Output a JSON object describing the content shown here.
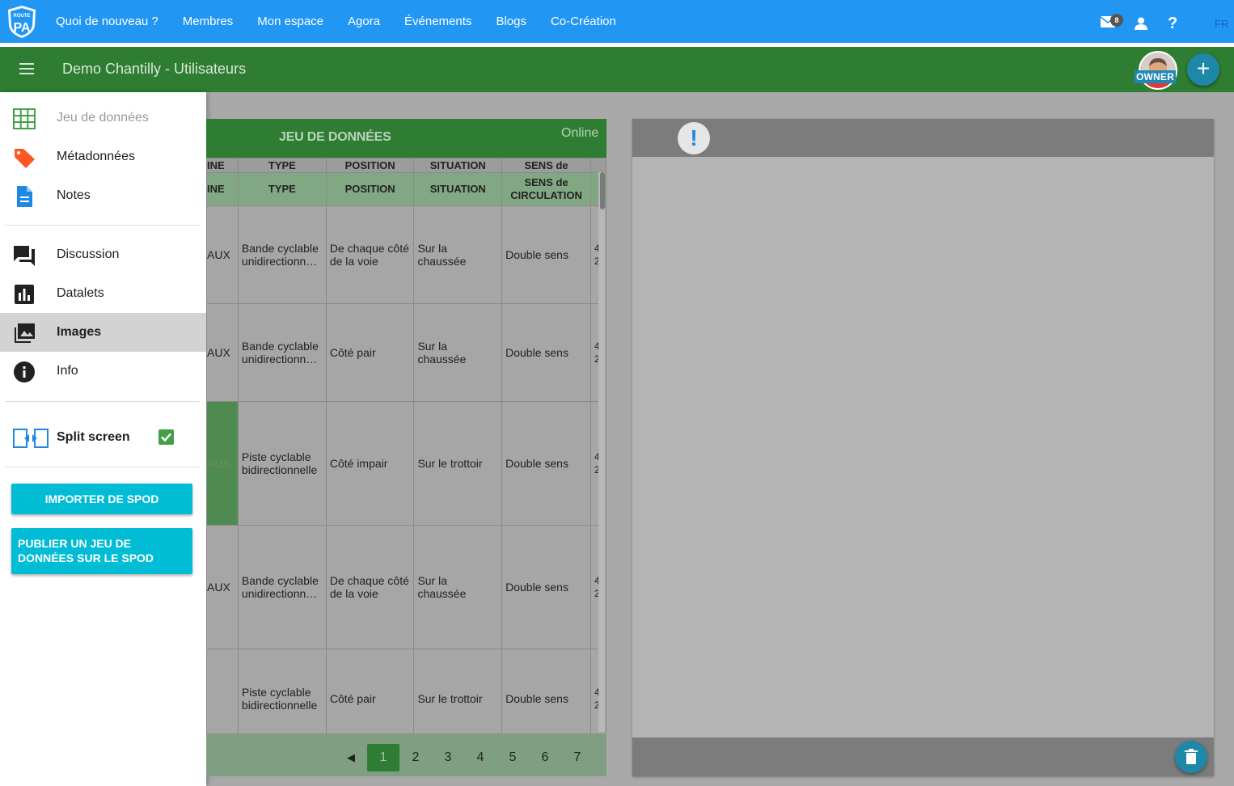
{
  "topnav": {
    "logo_text": "ROUTE TO PA",
    "links": [
      "Quoi de nouveau ?",
      "Membres",
      "Mon espace",
      "Agora",
      "Événements",
      "Blogs",
      "Co-Création"
    ],
    "mail_badge": "8",
    "help": "?",
    "lang": "FR"
  },
  "header": {
    "title": "Demo Chantilly - Utilisateurs",
    "owner_label": "OWNER",
    "add_label": "+"
  },
  "sidebar": {
    "items": [
      {
        "label": "Jeu de données",
        "icon": "grid-icon"
      },
      {
        "label": "Métadonnées",
        "icon": "tag-icon"
      },
      {
        "label": "Notes",
        "icon": "document-icon"
      },
      {
        "label": "Discussion",
        "icon": "forum-icon"
      },
      {
        "label": "Datalets",
        "icon": "bar-chart-icon"
      },
      {
        "label": "Images",
        "icon": "images-icon"
      },
      {
        "label": "Info",
        "icon": "info-icon"
      }
    ],
    "split_screen_label": "Split screen",
    "split_screen_checked": true,
    "import_button": "IMPORTER DE SPOD",
    "publish_button": "PUBLIER UN JEU DE DONNÉES SUR LE SPOD"
  },
  "dataset": {
    "title": "JEU DE DONNÉES",
    "status": "Online",
    "header_row1": [
      "INE",
      "TYPE",
      "POSITION",
      "SITUATION",
      "SENS de",
      ""
    ],
    "header_row2": [
      "INE",
      "TYPE",
      "POSITION",
      "SITUATION",
      "SENS de CIRCULATION",
      ""
    ],
    "rows": [
      {
        "c0": "AUX",
        "type": "Bande cyclable unidirectionn…",
        "position": "De chaque côté de la voie",
        "situation": "Sur la chaussée",
        "sens": "Double sens",
        "c5": "4 2"
      },
      {
        "c0": "AUX",
        "type": "Bande cyclable unidirectionn…",
        "position": "Côté pair",
        "situation": "Sur la chaussée",
        "sens": "Double sens",
        "c5": "4 2"
      },
      {
        "c0": "AUX",
        "type": "Piste cyclable bidirectionnelle",
        "position": "Côté impair",
        "situation": "Sur le trottoir",
        "sens": "Double sens",
        "c5": "4 2"
      },
      {
        "c0": "AUX",
        "type": "Bande cyclable unidirectionn…",
        "position": "De chaque côté de la voie",
        "situation": "Sur la chaussée",
        "sens": "Double sens",
        "c5": "4 2"
      },
      {
        "c0": "",
        "type": "Piste cyclable bidirectionnelle",
        "position": "Côté pair",
        "situation": "Sur le trottoir",
        "sens": "Double sens",
        "c5": "4 2"
      }
    ],
    "pager": {
      "prev": "◀",
      "pages": [
        "1",
        "2",
        "3",
        "4",
        "5",
        "6",
        "7"
      ],
      "current": "1"
    }
  },
  "preview": {
    "alert_symbol": "!"
  },
  "colors": {
    "nav_blue": "#2196f3",
    "header_green": "#2e7d32",
    "button_cyan": "#00bcd4",
    "fab_teal": "#1e88a8"
  }
}
